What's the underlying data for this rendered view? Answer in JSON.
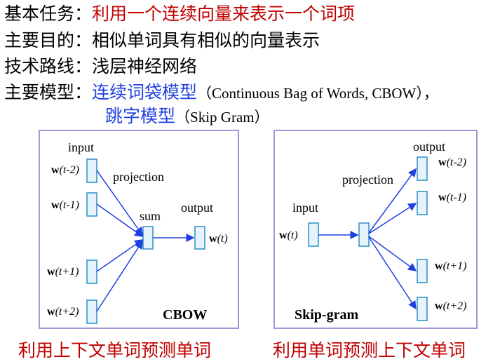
{
  "lines": [
    {
      "key": "基本任务：",
      "value": "利用一个连续向量来表示一个词项"
    },
    {
      "key": "主要目的：",
      "value": "相似单词具有相似的向量表示"
    },
    {
      "key": "技术路线：",
      "value": "浅层神经网络"
    },
    {
      "key": "主要模型：",
      "model1": "连续词袋模型",
      "model1_en": "（Continuous Bag of Words, CBOW），",
      "model2": "跳字模型",
      "model2_en": "（Skip Gram）"
    }
  ],
  "cbow": {
    "input_label": "input",
    "projection_label": "projection",
    "sum_label": "sum",
    "output_label": "output",
    "title": "CBOW",
    "inputs": [
      {
        "w": "w",
        "arg": "(t-2)"
      },
      {
        "w": "w",
        "arg": "(t-1)"
      },
      {
        "w": "w",
        "arg": "(t+1)"
      },
      {
        "w": "w",
        "arg": "(t+2)"
      }
    ],
    "output": {
      "w": "w",
      "arg": "(t)"
    }
  },
  "skipgram": {
    "input_label": "input",
    "projection_label": "projection",
    "output_label": "output",
    "title": "Skip-gram",
    "input": {
      "w": "w",
      "arg": "(t)"
    },
    "outputs": [
      {
        "w": "w",
        "arg": "(t-2)"
      },
      {
        "w": "w",
        "arg": "(t-1)"
      },
      {
        "w": "w",
        "arg": "(t+1)"
      },
      {
        "w": "w",
        "arg": "(t+2)"
      }
    ]
  },
  "captions": {
    "left": "利用上下文单词预测单词",
    "right": "利用单词预测上下文单词"
  },
  "colors": {
    "accent_red": "#c00000",
    "accent_blue": "#1f3fe0",
    "box_fill": "#e6f3fb",
    "box_stroke": "#2b8fc9",
    "arrow": "#1f3fe0"
  }
}
